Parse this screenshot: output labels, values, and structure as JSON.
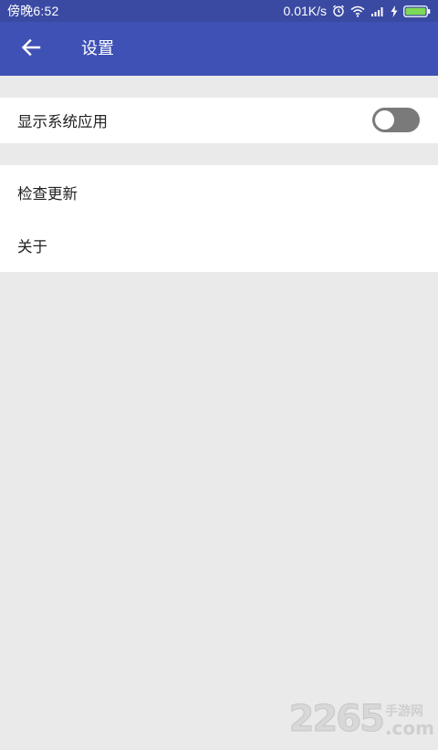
{
  "status_bar": {
    "time": "傍晚6:52",
    "net_speed": "0.01K/s",
    "icons": [
      "alarm-icon",
      "wifi-icon",
      "signal-icon",
      "charging-icon",
      "battery-icon"
    ],
    "color": "#3a4aa3"
  },
  "app_bar": {
    "title": "设置",
    "back_icon": "arrow-left-icon",
    "color": "#3f51b5"
  },
  "settings": {
    "show_system_apps": {
      "label": "显示系统应用",
      "enabled": false
    },
    "items": [
      {
        "label": "检查更新"
      },
      {
        "label": "关于"
      }
    ]
  },
  "watermark": {
    "digits": "2265",
    "text": "手游网",
    "domain": ".com"
  },
  "colors": {
    "background": "#eaeaea",
    "card": "#ffffff",
    "toggle_off_track": "#7a7a7a"
  }
}
